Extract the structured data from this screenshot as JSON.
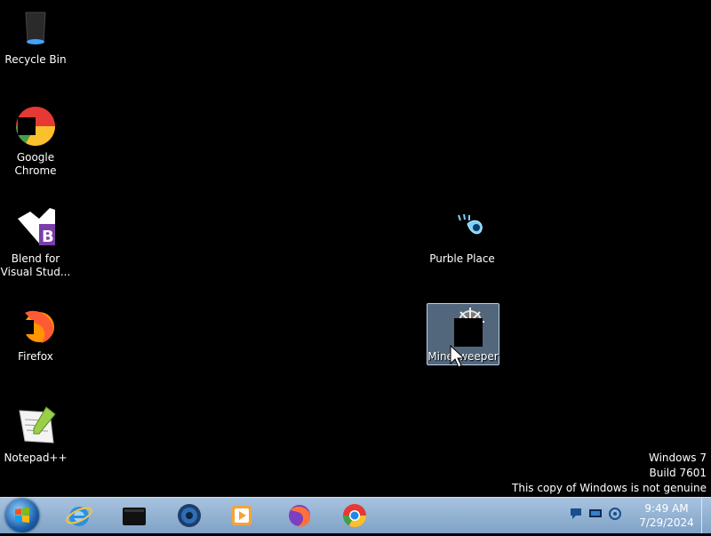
{
  "desktop": {
    "icons": [
      {
        "label": "Recycle Bin",
        "icon": "recycle-bin-icon"
      },
      {
        "label": "Google Chrome",
        "icon": "chrome-icon"
      },
      {
        "label": "Blend for Visual Stud...",
        "icon": "blend-icon"
      },
      {
        "label": "Firefox",
        "icon": "firefox-icon"
      },
      {
        "label": "Notepad++",
        "icon": "notepadpp-icon"
      },
      {
        "label": "Purble Place",
        "icon": "purble-place-icon"
      },
      {
        "label": "Minesweeper",
        "icon": "minesweeper-icon",
        "selected": true
      }
    ]
  },
  "watermark": {
    "line1": "Windows 7",
    "line2": "Build 7601",
    "line3": "This copy of Windows is not genuine"
  },
  "taskbar": {
    "pinned": [
      "Internet Explorer",
      "Media Center",
      "Windows Media Player",
      "Media Player",
      "Firefox",
      "Google Chrome"
    ],
    "clock": {
      "time": "9:49 AM",
      "date": "7/29/2024"
    }
  },
  "colors": {
    "desktop": "#000000",
    "taskbar": "#9bb9d8",
    "selection": "#a6c0e0"
  }
}
